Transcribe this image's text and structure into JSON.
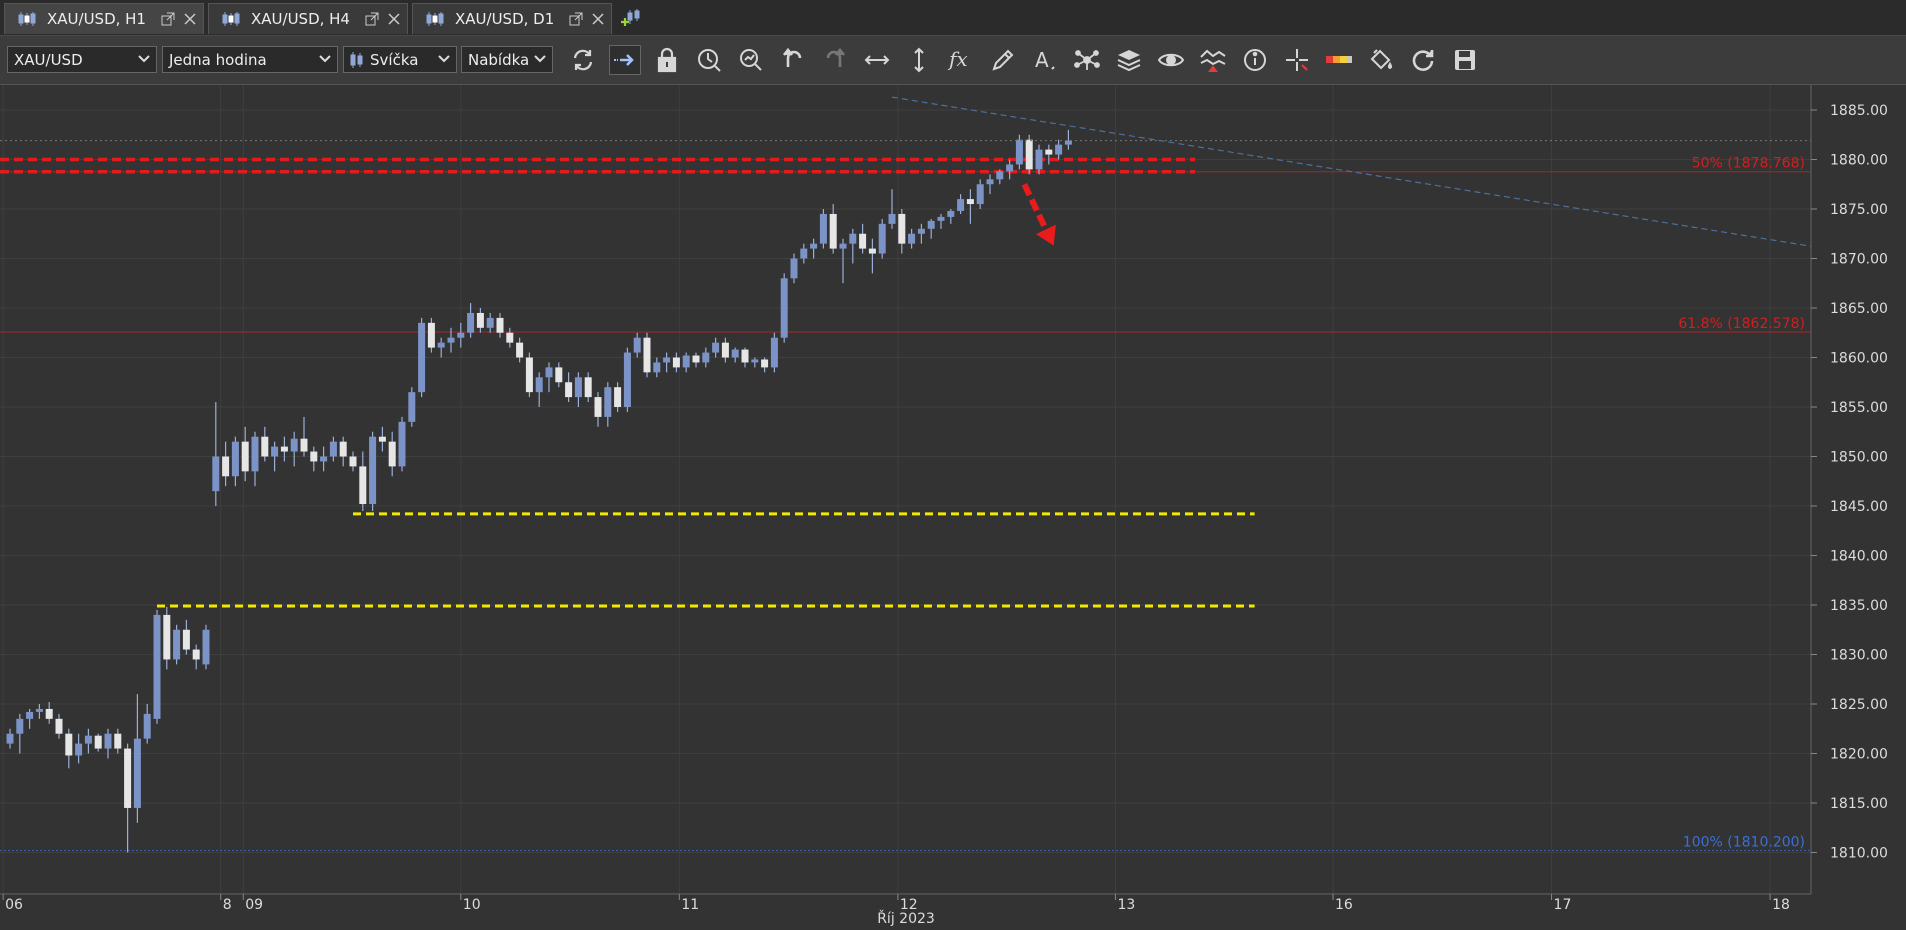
{
  "tabs": [
    {
      "label": "XAU/USD, H1",
      "active": true
    },
    {
      "label": "XAU/USD, H4",
      "active": false
    },
    {
      "label": "XAU/USD, D1",
      "active": false
    }
  ],
  "toolbar": {
    "instrument": "XAU/USD",
    "period": "Jedna hodina",
    "chart_type": "Svíčka",
    "price_side": "Nabídka",
    "icons": [
      "refresh-icon",
      "shift-icon",
      "lock-icon",
      "zoom-period-icon",
      "zoom-icon",
      "undo-icon",
      "redo-icon",
      "fit-horizontal-icon",
      "fit-vertical-icon",
      "indicator-fx-icon",
      "pencil-icon",
      "text-tool-icon",
      "pattern-icon",
      "layers-icon",
      "eye-icon",
      "signal-icon",
      "info-icon",
      "crosshair-icon",
      "color-scale-icon",
      "paint-bucket-icon",
      "reload-icon",
      "save-icon"
    ]
  },
  "chart_data": {
    "type": "candlestick",
    "instrument": "XAU/USD",
    "timeframe": "H1",
    "ylim": [
      1805.5,
      1888.5
    ],
    "y_ticks": [
      "1885.00",
      "1880.00",
      "1875.00",
      "1870.00",
      "1865.00",
      "1860.00",
      "1855.00",
      "1850.00",
      "1845.00",
      "1840.00",
      "1835.00",
      "1830.00",
      "1825.00",
      "1820.00",
      "1815.00",
      "1810.00"
    ],
    "x_ticks": [
      {
        "label": "06",
        "bar": -0.7
      },
      {
        "label": "8",
        "bar": 21.5
      },
      {
        "label": "09",
        "bar": 23.8
      },
      {
        "label": "10",
        "bar": 46
      },
      {
        "label": "11",
        "bar": 68.3
      },
      {
        "label": "12",
        "bar": 90.6
      },
      {
        "label": "13",
        "bar": 112.8
      },
      {
        "label": "16",
        "bar": 135
      },
      {
        "label": "17",
        "bar": 157.3
      },
      {
        "label": "18",
        "bar": 179.6
      }
    ],
    "x_axis_month": "Říj 2023",
    "current_price": "1881.908",
    "fibonacci": [
      {
        "label": "50% (1878.768)",
        "price": 1878.768,
        "color": "#d21f1f"
      },
      {
        "label": "61.8% (1862.578)",
        "price": 1862.578,
        "color": "#d21f1f"
      },
      {
        "label": "100% (1810.200)",
        "price": 1810.2,
        "color": "#3a6fd8"
      }
    ],
    "red_dashed_levels": [
      1880.0,
      1878.768
    ],
    "yellow_levels": [
      {
        "price": 1844.2,
        "from_bar": 35,
        "to_bar": 127
      },
      {
        "price": 1834.9,
        "from_bar": 15,
        "to_bar": 127
      }
    ],
    "trendline": {
      "from": {
        "bar": 90,
        "price": 1886.3
      },
      "to": {
        "bar": 184,
        "price": 1871.2
      }
    },
    "arrow": {
      "from": {
        "bar": 103.5,
        "price": 1877.5
      },
      "to": {
        "bar": 106.5,
        "price": 1871.3
      }
    },
    "grid": true,
    "candles": [
      [
        1821.0,
        1822.5,
        1820.5,
        1822.0
      ],
      [
        1822.0,
        1824.0,
        1820.0,
        1823.5
      ],
      [
        1823.5,
        1824.5,
        1822.5,
        1824.2
      ],
      [
        1824.2,
        1825.0,
        1823.5,
        1824.5
      ],
      [
        1824.5,
        1825.2,
        1823.0,
        1823.5
      ],
      [
        1823.5,
        1824.0,
        1821.5,
        1822.0
      ],
      [
        1822.0,
        1822.5,
        1818.5,
        1819.8
      ],
      [
        1819.8,
        1822.0,
        1819.0,
        1821.0
      ],
      [
        1821.0,
        1822.5,
        1820.0,
        1821.8
      ],
      [
        1821.8,
        1822.0,
        1820.2,
        1820.5
      ],
      [
        1820.5,
        1822.5,
        1819.5,
        1822.0
      ],
      [
        1822.0,
        1822.5,
        1820.0,
        1820.5
      ],
      [
        1820.5,
        1821.0,
        1810.0,
        1814.5
      ],
      [
        1814.5,
        1826.0,
        1813.0,
        1821.5
      ],
      [
        1821.5,
        1825.0,
        1821.0,
        1824.0
      ],
      [
        1823.5,
        1834.5,
        1823.0,
        1834.0
      ],
      [
        1834.0,
        1834.8,
        1828.5,
        1829.5
      ],
      [
        1829.5,
        1833.0,
        1829.0,
        1832.5
      ],
      [
        1832.5,
        1833.5,
        1830.0,
        1830.5
      ],
      [
        1830.5,
        1831.0,
        1828.5,
        1829.5
      ],
      [
        1829.0,
        1833.0,
        1828.5,
        1832.5
      ],
      [
        1846.5,
        1855.5,
        1845.0,
        1850.0
      ],
      [
        1850.0,
        1851.5,
        1847.0,
        1848.0
      ],
      [
        1848.0,
        1852.0,
        1847.0,
        1851.5
      ],
      [
        1851.5,
        1853.0,
        1847.5,
        1848.5
      ],
      [
        1848.5,
        1852.5,
        1847.0,
        1852.0
      ],
      [
        1852.0,
        1853.0,
        1849.5,
        1850.0
      ],
      [
        1850.0,
        1851.5,
        1848.5,
        1851.0
      ],
      [
        1851.0,
        1852.0,
        1849.5,
        1850.5
      ],
      [
        1850.5,
        1852.5,
        1849.0,
        1851.8
      ],
      [
        1851.8,
        1854.0,
        1850.0,
        1850.5
      ],
      [
        1850.5,
        1851.0,
        1848.5,
        1849.5
      ],
      [
        1849.5,
        1851.0,
        1848.5,
        1850.0
      ],
      [
        1850.0,
        1852.0,
        1849.5,
        1851.5
      ],
      [
        1851.5,
        1852.0,
        1849.0,
        1850.0
      ],
      [
        1850.0,
        1850.5,
        1848.5,
        1849.0
      ],
      [
        1849.0,
        1850.5,
        1844.5,
        1845.2
      ],
      [
        1845.2,
        1852.5,
        1844.5,
        1852.0
      ],
      [
        1852.0,
        1853.0,
        1850.5,
        1851.5
      ],
      [
        1851.5,
        1852.5,
        1848.0,
        1849.0
      ],
      [
        1849.0,
        1854.0,
        1848.5,
        1853.5
      ],
      [
        1853.5,
        1857.0,
        1853.0,
        1856.5
      ],
      [
        1856.5,
        1864.0,
        1856.0,
        1863.5
      ],
      [
        1863.5,
        1864.0,
        1860.5,
        1861.0
      ],
      [
        1861.0,
        1862.0,
        1860.0,
        1861.5
      ],
      [
        1861.5,
        1863.0,
        1860.5,
        1862.0
      ],
      [
        1862.0,
        1863.5,
        1861.0,
        1862.5
      ],
      [
        1862.5,
        1865.5,
        1862.0,
        1864.5
      ],
      [
        1864.5,
        1865.0,
        1862.5,
        1863.0
      ],
      [
        1863.0,
        1864.5,
        1862.5,
        1864.0
      ],
      [
        1864.0,
        1864.5,
        1862.0,
        1862.5
      ],
      [
        1862.5,
        1863.0,
        1861.0,
        1861.5
      ],
      [
        1861.5,
        1862.0,
        1859.5,
        1860.0
      ],
      [
        1860.0,
        1860.5,
        1856.0,
        1856.5
      ],
      [
        1856.5,
        1858.5,
        1855.0,
        1858.0
      ],
      [
        1858.0,
        1859.5,
        1856.5,
        1859.0
      ],
      [
        1859.0,
        1859.5,
        1857.0,
        1857.5
      ],
      [
        1857.5,
        1858.5,
        1855.5,
        1856.0
      ],
      [
        1856.0,
        1858.5,
        1855.0,
        1858.0
      ],
      [
        1858.0,
        1858.5,
        1855.5,
        1856.0
      ],
      [
        1856.0,
        1856.5,
        1853.0,
        1854.0
      ],
      [
        1854.0,
        1857.5,
        1853.0,
        1857.0
      ],
      [
        1857.0,
        1857.5,
        1854.5,
        1855.0
      ],
      [
        1855.0,
        1861.0,
        1854.5,
        1860.5
      ],
      [
        1860.5,
        1862.5,
        1860.0,
        1862.0
      ],
      [
        1862.0,
        1862.5,
        1858.0,
        1858.5
      ],
      [
        1858.5,
        1860.0,
        1858.0,
        1859.5
      ],
      [
        1859.5,
        1860.5,
        1858.5,
        1860.0
      ],
      [
        1860.0,
        1860.5,
        1858.5,
        1859.0
      ],
      [
        1859.0,
        1860.5,
        1858.5,
        1860.2
      ],
      [
        1860.2,
        1860.5,
        1859.0,
        1859.5
      ],
      [
        1859.5,
        1861.0,
        1859.0,
        1860.5
      ],
      [
        1860.5,
        1862.0,
        1860.0,
        1861.5
      ],
      [
        1861.5,
        1862.0,
        1859.5,
        1860.0
      ],
      [
        1860.0,
        1861.0,
        1859.5,
        1860.8
      ],
      [
        1860.8,
        1861.0,
        1859.0,
        1859.5
      ],
      [
        1859.5,
        1860.0,
        1859.0,
        1859.8
      ],
      [
        1859.8,
        1860.0,
        1858.5,
        1859.0
      ],
      [
        1859.0,
        1862.5,
        1858.5,
        1862.0
      ],
      [
        1862.0,
        1868.5,
        1861.5,
        1868.0
      ],
      [
        1868.0,
        1870.5,
        1867.5,
        1870.0
      ],
      [
        1870.0,
        1871.5,
        1869.5,
        1871.0
      ],
      [
        1871.0,
        1872.0,
        1870.0,
        1871.5
      ],
      [
        1871.5,
        1875.0,
        1871.0,
        1874.5
      ],
      [
        1874.5,
        1875.5,
        1870.5,
        1871.0
      ],
      [
        1871.0,
        1872.0,
        1867.5,
        1871.5
      ],
      [
        1871.5,
        1873.0,
        1869.5,
        1872.5
      ],
      [
        1872.5,
        1873.5,
        1870.5,
        1871.0
      ],
      [
        1871.0,
        1872.0,
        1868.5,
        1870.5
      ],
      [
        1870.5,
        1874.0,
        1870.0,
        1873.5
      ],
      [
        1873.5,
        1877.0,
        1873.0,
        1874.5
      ],
      [
        1874.5,
        1875.0,
        1870.5,
        1871.5
      ],
      [
        1871.5,
        1873.0,
        1871.0,
        1872.5
      ],
      [
        1872.5,
        1873.5,
        1871.5,
        1873.0
      ],
      [
        1873.0,
        1874.0,
        1872.0,
        1873.8
      ],
      [
        1873.8,
        1874.5,
        1873.0,
        1874.2
      ],
      [
        1874.2,
        1875.0,
        1873.5,
        1874.8
      ],
      [
        1874.8,
        1876.5,
        1874.5,
        1876.0
      ],
      [
        1876.0,
        1877.0,
        1873.5,
        1875.5
      ],
      [
        1875.5,
        1878.0,
        1875.0,
        1877.5
      ],
      [
        1877.5,
        1878.5,
        1876.5,
        1878.0
      ],
      [
        1878.0,
        1879.0,
        1877.5,
        1878.8
      ],
      [
        1878.8,
        1880.0,
        1878.0,
        1879.5
      ],
      [
        1879.5,
        1882.5,
        1879.0,
        1882.0
      ],
      [
        1882.0,
        1882.5,
        1878.5,
        1879.0
      ],
      [
        1879.0,
        1881.5,
        1878.5,
        1881.0
      ],
      [
        1881.0,
        1881.5,
        1879.5,
        1880.5
      ],
      [
        1880.5,
        1882.0,
        1880.0,
        1881.5
      ],
      [
        1881.5,
        1883.0,
        1881.0,
        1881.9
      ]
    ]
  }
}
